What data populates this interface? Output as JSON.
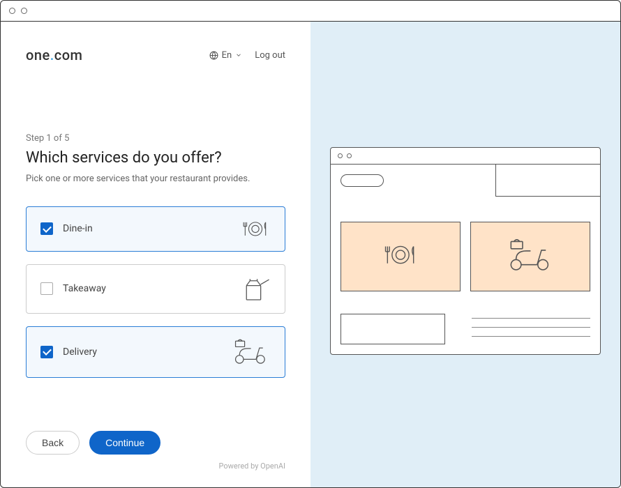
{
  "brand": {
    "text_left": "one",
    "text_right": "com"
  },
  "header": {
    "lang_label": "En",
    "logout_label": "Log out"
  },
  "wizard": {
    "step_label": "Step 1 of 5",
    "heading": "Which services do you offer?",
    "subtext": "Pick one or more services that your restaurant provides."
  },
  "options": [
    {
      "id": "dine-in",
      "label": "Dine-in",
      "selected": true,
      "icon": "plate"
    },
    {
      "id": "takeaway",
      "label": "Takeaway",
      "selected": false,
      "icon": "bag"
    },
    {
      "id": "delivery",
      "label": "Delivery",
      "selected": true,
      "icon": "scooter"
    }
  ],
  "buttons": {
    "back": "Back",
    "continue": "Continue"
  },
  "footer": {
    "powered": "Powered by OpenAI"
  },
  "preview": {
    "cards": [
      "plate",
      "scooter"
    ]
  }
}
